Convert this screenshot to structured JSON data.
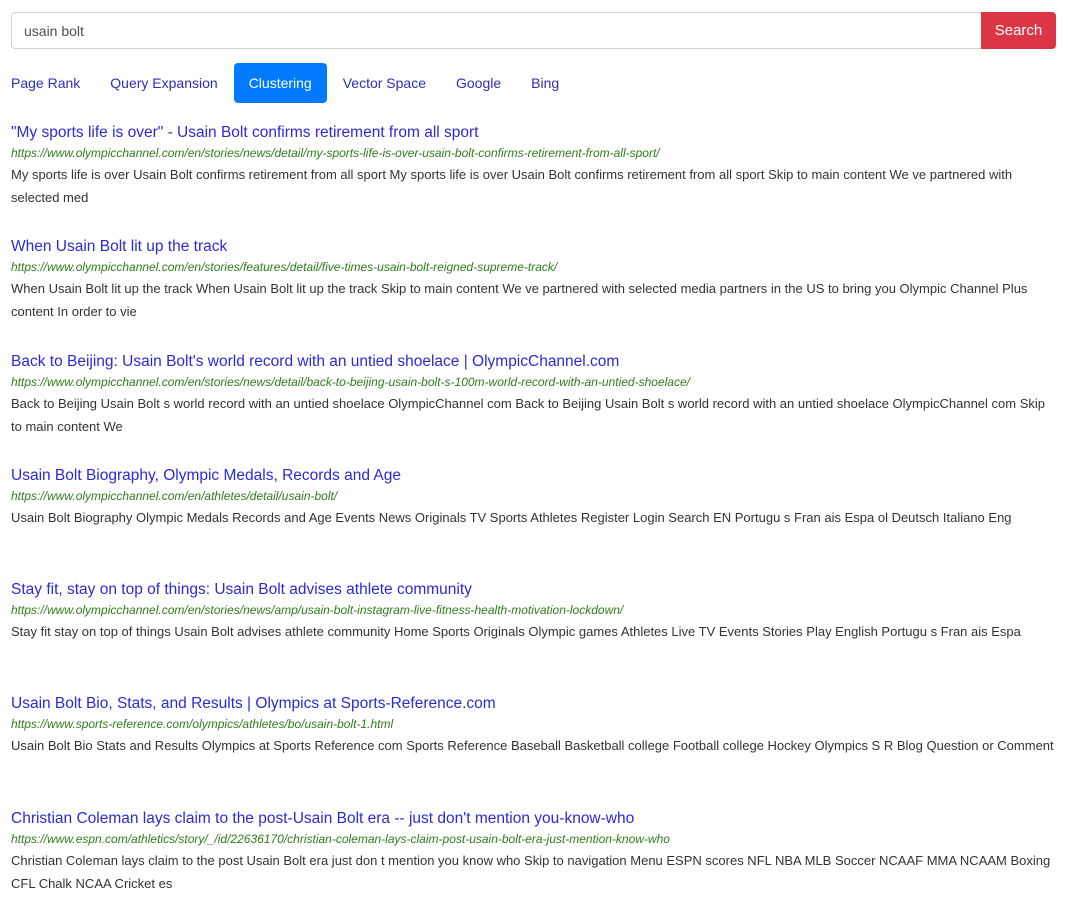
{
  "search": {
    "value": "usain bolt",
    "button_label": "Search"
  },
  "tabs": [
    {
      "label": "Page Rank",
      "active": false
    },
    {
      "label": "Query Expansion",
      "active": false
    },
    {
      "label": "Clustering",
      "active": true
    },
    {
      "label": "Vector Space",
      "active": false
    },
    {
      "label": "Google",
      "active": false
    },
    {
      "label": "Bing",
      "active": false
    }
  ],
  "colors": {
    "search_button": "#dc3545",
    "active_tab": "#007bff",
    "link": "#2b2bd4",
    "url": "#2f7d1c"
  },
  "results": [
    {
      "title": "\"My sports life is over\" - Usain Bolt confirms retirement from all sport",
      "url": "https://www.olympicchannel.com/en/stories/news/detail/my-sports-life-is-over-usain-bolt-confirms-retirement-from-all-sport/",
      "snippet": "My sports life is over Usain Bolt confirms retirement from all sport My sports life is over Usain Bolt confirms retirement from all sport Skip to main content We ve partnered with selected med"
    },
    {
      "title": "When Usain Bolt lit up the track",
      "url": "https://www.olympicchannel.com/en/stories/features/detail/five-times-usain-bolt-reigned-supreme-track/",
      "snippet": "When Usain Bolt lit up the track When Usain Bolt lit up the track Skip to main content We ve partnered with selected media partners in the US to bring you Olympic Channel Plus content In order to vie"
    },
    {
      "title": "Back to Beijing: Usain Bolt's world record with an untied shoelace | OlympicChannel.com",
      "url": "https://www.olympicchannel.com/en/stories/news/detail/back-to-beijing-usain-bolt-s-100m-world-record-with-an-untied-shoelace/",
      "snippet": "Back to Beijing Usain Bolt s world record with an untied shoelace OlympicChannel com Back to Beijing Usain Bolt s world record with an untied shoelace OlympicChannel com Skip to main content We"
    },
    {
      "title": "Usain Bolt Biography, Olympic Medals, Records and Age",
      "url": "https://www.olympicchannel.com/en/athletes/detail/usain-bolt/",
      "snippet": "Usain Bolt Biography Olympic Medals Records and Age Events News Originals TV Sports Athletes Register Login Search EN Portugu s Fran ais Espa ol Deutsch Italiano Eng"
    },
    {
      "title": "Stay fit, stay on top of things: Usain Bolt advises athlete community",
      "url": "https://www.olympicchannel.com/en/stories/news/amp/usain-bolt-instagram-live-fitness-health-motivation-lockdown/",
      "snippet": "Stay fit stay on top of things Usain Bolt advises athlete community Home Sports Originals Olympic games Athletes Live TV Events Stories Play English Portugu s Fran ais Espa"
    },
    {
      "title": "Usain Bolt Bio, Stats, and Results | Olympics at Sports-Reference.com",
      "url": "https://www.sports-reference.com/olympics/athletes/bo/usain-bolt-1.html",
      "snippet": "Usain Bolt Bio Stats and Results Olympics at Sports Reference com Sports Reference Baseball Basketball college Football college Hockey Olympics S R Blog Question or Comment"
    },
    {
      "title": "Christian Coleman lays claim to the post-Usain Bolt era -- just don't mention you-know-who",
      "url": "https://www.espn.com/athletics/story/_/id/22636170/christian-coleman-lays-claim-post-usain-bolt-era-just-mention-know-who",
      "snippet": "Christian Coleman lays claim to the post Usain Bolt era just don t mention you know who Skip to navigation Menu ESPN scores NFL NBA MLB Soccer NCAAF MMA NCAAM Boxing CFL Chalk NCAA Cricket es"
    }
  ]
}
